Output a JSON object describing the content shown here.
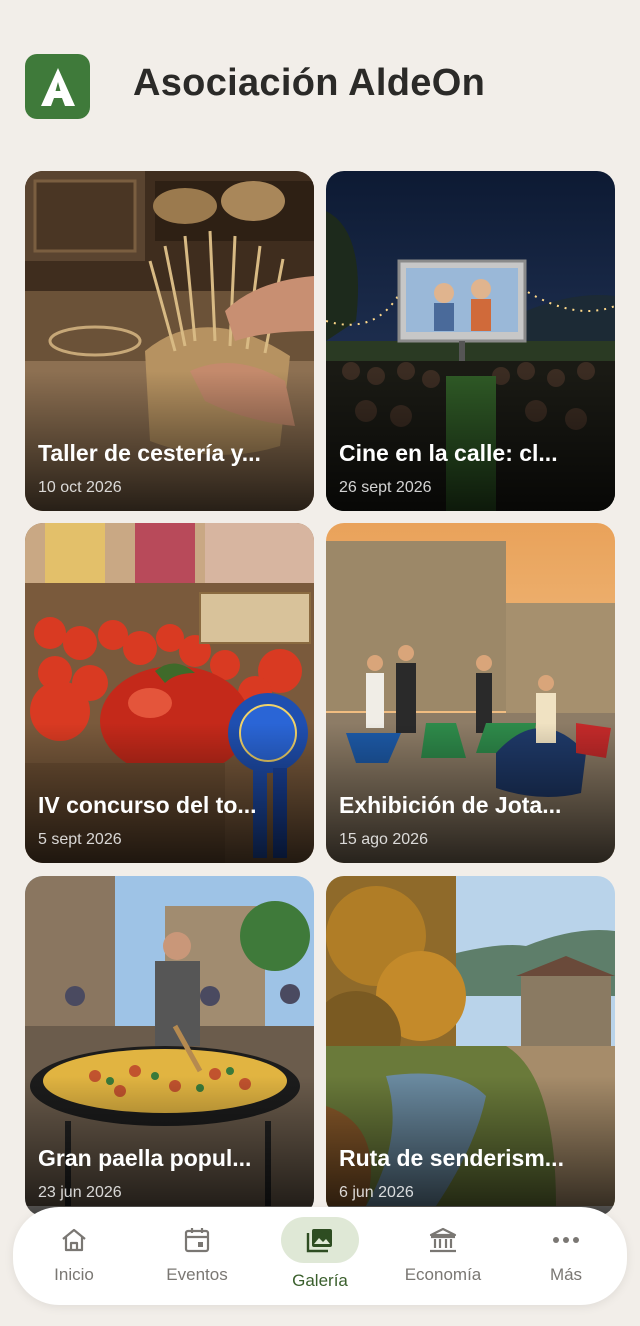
{
  "header": {
    "title": "Asociación AldeOn",
    "logo_letter": "A"
  },
  "gallery": [
    {
      "title": "Taller de cestería y...",
      "date": "10 oct 2026"
    },
    {
      "title": "Cine en la calle: cl...",
      "date": "26 sept 2026"
    },
    {
      "title": "IV concurso del to...",
      "date": "5 sept 2026"
    },
    {
      "title": "Exhibición de Jota...",
      "date": "15 ago 2026"
    },
    {
      "title": "Gran paella popul...",
      "date": "23 jun 2026"
    },
    {
      "title": "Ruta de senderism...",
      "date": "6 jun 2026"
    }
  ],
  "nav": [
    {
      "label": "Inicio",
      "icon": "home-icon"
    },
    {
      "label": "Eventos",
      "icon": "calendar-icon"
    },
    {
      "label": "Galería",
      "icon": "gallery-icon",
      "active": true
    },
    {
      "label": "Economía",
      "icon": "bank-icon"
    },
    {
      "label": "Más",
      "icon": "more-icon"
    }
  ],
  "colors": {
    "brand": "#3f7a3a",
    "active_pill": "#dfe8d6",
    "background": "#f2eee9"
  }
}
